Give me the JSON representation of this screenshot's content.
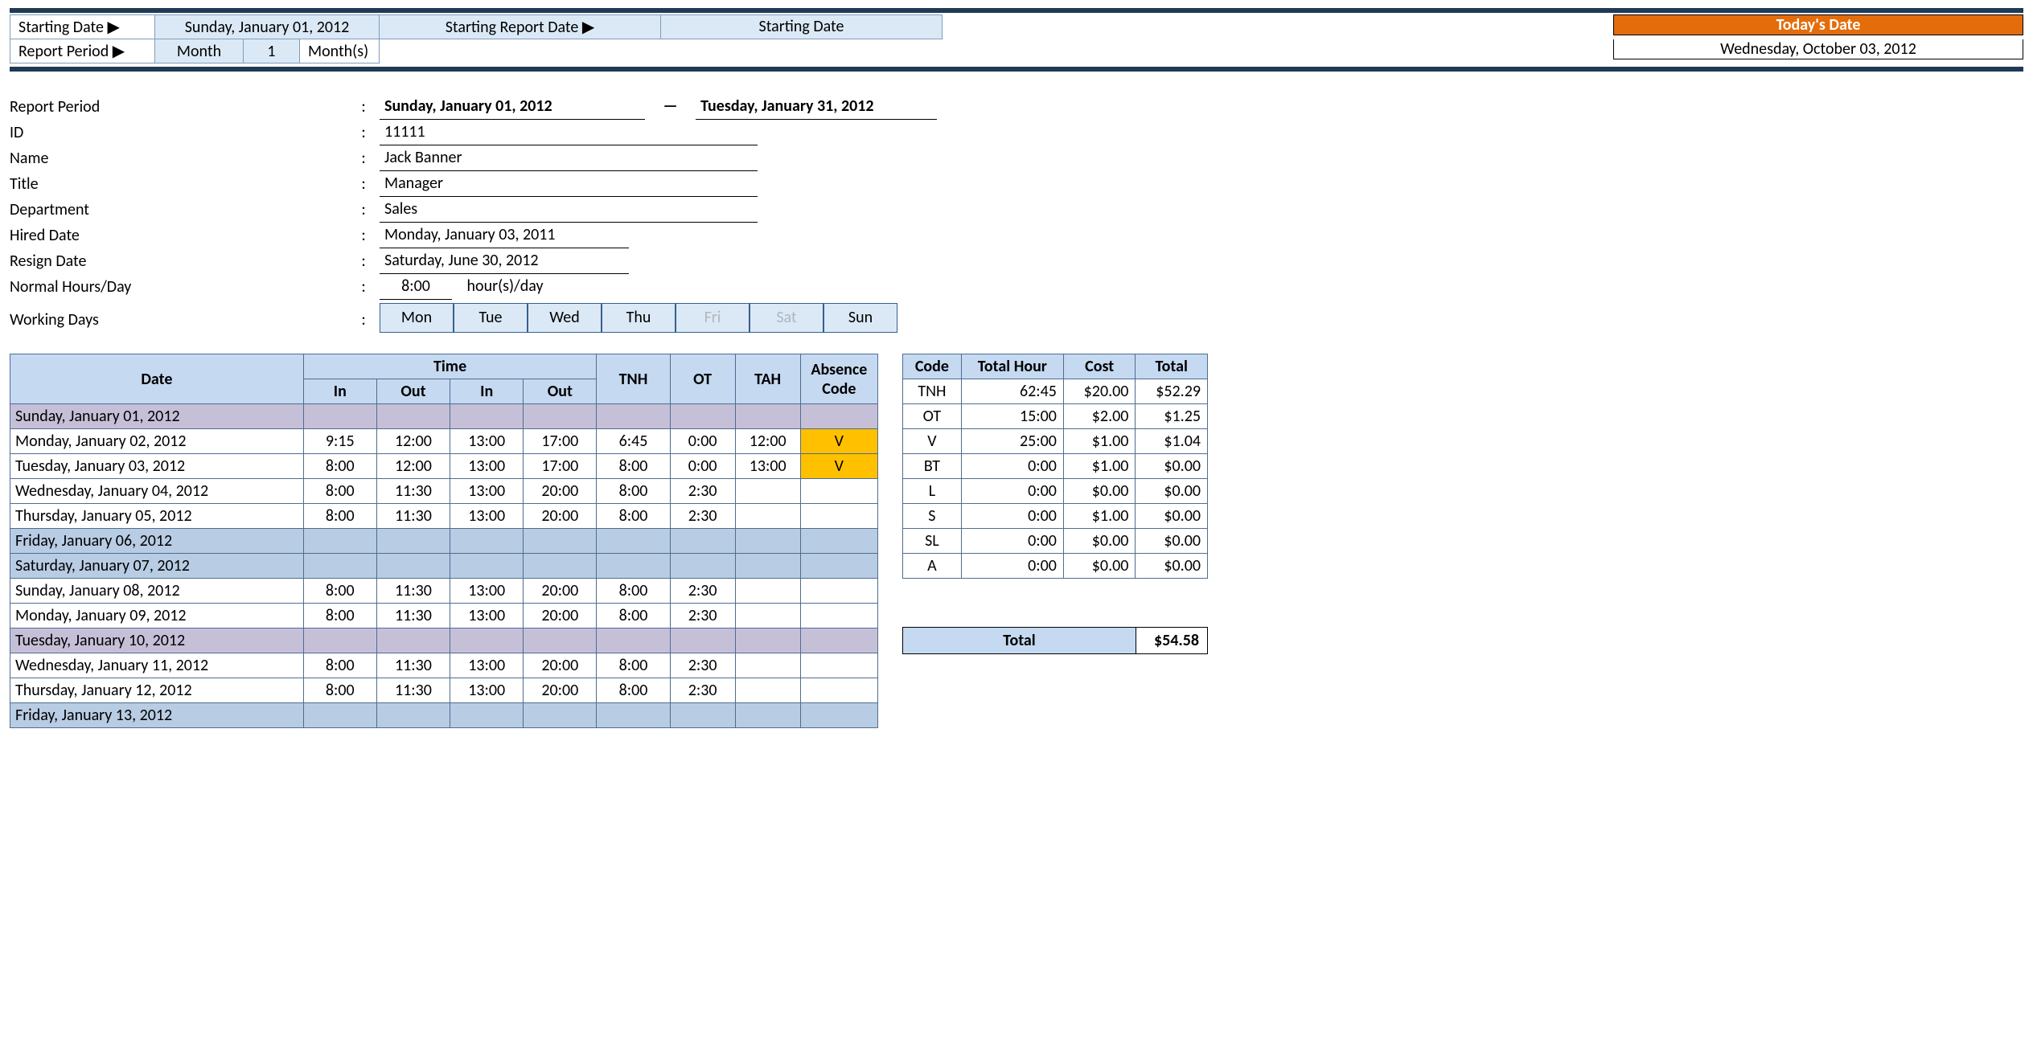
{
  "header": {
    "starting_date_lbl": "Starting Date ▶",
    "starting_date_val": "Sunday, January 01, 2012",
    "report_period_lbl": "Report Period ▶",
    "period_unit": "Month",
    "period_qty": "1",
    "period_suffix": "Month(s)",
    "srd_lbl": "Starting Report Date ▶",
    "srd_val": "Starting Date",
    "today_lbl": "Today's Date",
    "today_val": "Wednesday, October 03, 2012"
  },
  "info": {
    "report_period_lbl": "Report Period",
    "rp_from": "Sunday, January 01, 2012",
    "rp_to": "Tuesday, January 31, 2012",
    "id_lbl": "ID",
    "id": "11111",
    "name_lbl": "Name",
    "name": "Jack Banner",
    "title_lbl": "Title",
    "title": "Manager",
    "dept_lbl": "Department",
    "dept": "Sales",
    "hired_lbl": "Hired Date",
    "hired": "Monday, January 03, 2011",
    "resign_lbl": "Resign Date",
    "resign": "Saturday, June 30, 2012",
    "nhd_lbl": "Normal Hours/Day",
    "nhd_val": "8:00",
    "nhd_unit": "hour(s)/day",
    "wd_lbl": "Working Days",
    "days": [
      "Mon",
      "Tue",
      "Wed",
      "Thu",
      "Fri",
      "Sat",
      "Sun"
    ]
  },
  "ts_head": {
    "date": "Date",
    "time": "Time",
    "in": "In",
    "out": "Out",
    "tnh": "TNH",
    "ot": "OT",
    "tah": "TAH",
    "abs": "Absence Code"
  },
  "rows": [
    {
      "cls": "purple",
      "date": "Sunday, January 01, 2012"
    },
    {
      "date": "Monday, January 02, 2012",
      "in1": "9:15",
      "out1": "12:00",
      "in2": "13:00",
      "out2": "17:00",
      "tnh": "6:45",
      "ot": "0:00",
      "tah": "12:00",
      "abs": "V"
    },
    {
      "date": "Tuesday, January 03, 2012",
      "in1": "8:00",
      "out1": "12:00",
      "in2": "13:00",
      "out2": "17:00",
      "tnh": "8:00",
      "ot": "0:00",
      "tah": "13:00",
      "abs": "V"
    },
    {
      "date": "Wednesday, January 04, 2012",
      "in1": "8:00",
      "out1": "11:30",
      "in2": "13:00",
      "out2": "20:00",
      "tnh": "8:00",
      "ot": "2:30"
    },
    {
      "date": "Thursday, January 05, 2012",
      "in1": "8:00",
      "out1": "11:30",
      "in2": "13:00",
      "out2": "20:00",
      "tnh": "8:00",
      "ot": "2:30"
    },
    {
      "cls": "blue",
      "date": "Friday, January 06, 2012"
    },
    {
      "cls": "blue",
      "date": "Saturday, January 07, 2012"
    },
    {
      "date": "Sunday, January 08, 2012",
      "in1": "8:00",
      "out1": "11:30",
      "in2": "13:00",
      "out2": "20:00",
      "tnh": "8:00",
      "ot": "2:30"
    },
    {
      "date": "Monday, January 09, 2012",
      "in1": "8:00",
      "out1": "11:30",
      "in2": "13:00",
      "out2": "20:00",
      "tnh": "8:00",
      "ot": "2:30"
    },
    {
      "cls": "purple",
      "date": "Tuesday, January 10, 2012"
    },
    {
      "date": "Wednesday, January 11, 2012",
      "in1": "8:00",
      "out1": "11:30",
      "in2": "13:00",
      "out2": "20:00",
      "tnh": "8:00",
      "ot": "2:30"
    },
    {
      "date": "Thursday, January 12, 2012",
      "in1": "8:00",
      "out1": "11:30",
      "in2": "13:00",
      "out2": "20:00",
      "tnh": "8:00",
      "ot": "2:30"
    },
    {
      "cls": "blue",
      "date": "Friday, January 13, 2012"
    }
  ],
  "sum_head": {
    "code": "Code",
    "hour": "Total Hour",
    "cost": "Cost",
    "total": "Total"
  },
  "sum": [
    {
      "code": "TNH",
      "hour": "62:45",
      "cost": "$20.00",
      "total": "$52.29"
    },
    {
      "code": "OT",
      "hour": "15:00",
      "cost": "$2.00",
      "total": "$1.25"
    },
    {
      "code": "V",
      "hour": "25:00",
      "cost": "$1.00",
      "total": "$1.04"
    },
    {
      "code": "BT",
      "hour": "0:00",
      "cost": "$1.00",
      "total": "$0.00"
    },
    {
      "code": "L",
      "hour": "0:00",
      "cost": "$0.00",
      "total": "$0.00"
    },
    {
      "code": "S",
      "hour": "0:00",
      "cost": "$1.00",
      "total": "$0.00"
    },
    {
      "code": "SL",
      "hour": "0:00",
      "cost": "$0.00",
      "total": "$0.00"
    },
    {
      "code": "A",
      "hour": "0:00",
      "cost": "$0.00",
      "total": "$0.00"
    }
  ],
  "grand": {
    "lbl": "Total",
    "val": "$54.58"
  }
}
